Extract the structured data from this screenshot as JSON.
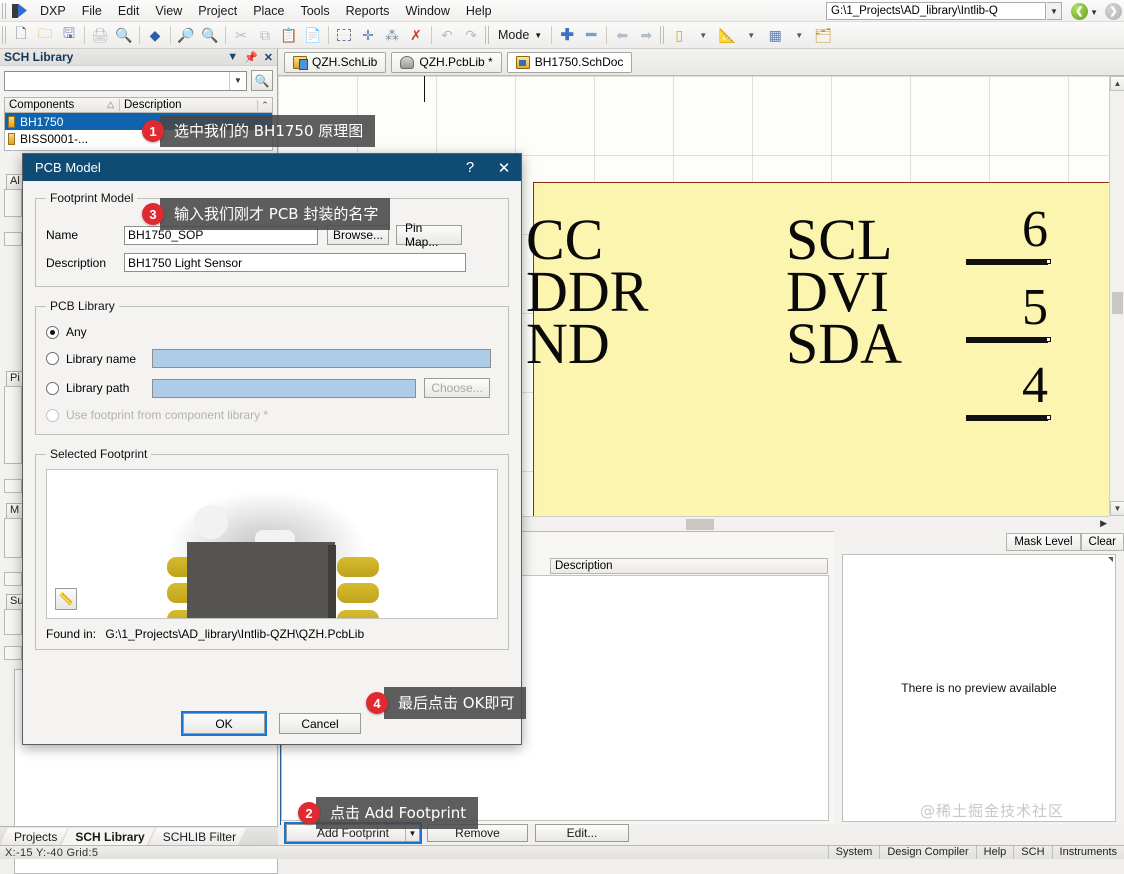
{
  "menu": {
    "app_name": "DXP",
    "items": [
      "File",
      "Edit",
      "View",
      "Project",
      "Place",
      "Tools",
      "Reports",
      "Window",
      "Help"
    ],
    "path_value": "G:\\1_Projects\\AD_library\\Intlib-Q"
  },
  "toolbar": {
    "mode_label": "Mode"
  },
  "sch_library_panel": {
    "title": "SCH Library",
    "search_value": "",
    "columns": [
      "Components",
      "Description"
    ],
    "components": [
      {
        "name": "BH1750",
        "description": "",
        "selected": true
      },
      {
        "name": "BISS0001-...",
        "description": "",
        "selected": false
      }
    ]
  },
  "hidden_sections": [
    {
      "label": "Al"
    },
    {
      "label": "Pi"
    },
    {
      "label": "M"
    },
    {
      "label": "Su"
    }
  ],
  "doc_tabs": [
    {
      "label": "QZH.SchLib",
      "icon": "schlib-icon",
      "active": false
    },
    {
      "label": "QZH.PcbLib *",
      "icon": "pcblib-icon",
      "active": false
    },
    {
      "label": "BH1750.SchDoc",
      "icon": "schdoc-icon",
      "active": true
    }
  ],
  "schematic": {
    "left_pins": [
      "CC",
      "DDR",
      "ND"
    ],
    "right_pins": [
      "SCL",
      "DVI",
      "SDA"
    ],
    "pin_numbers": [
      "6",
      "5",
      "4"
    ]
  },
  "lower_panel": {
    "description_header": "Description"
  },
  "right_panel": {
    "mask_level_label": "Mask Level",
    "clear_label": "Clear",
    "preview_message": "There is no preview available",
    "watermark": "@稀土掘金技术社区"
  },
  "footer_buttons": {
    "add_footprint": "Add Footprint",
    "remove": "Remove",
    "edit": "Edit..."
  },
  "bottom_tabs": [
    {
      "label": "Projects",
      "active": false
    },
    {
      "label": "SCH Library",
      "active": true
    },
    {
      "label": "SCHLIB Filter",
      "active": false
    }
  ],
  "status_bar": {
    "coordinates": "X:-15 Y:-40   Grid:5",
    "right_items": [
      "System",
      "Design Compiler",
      "Help",
      "SCH",
      "Instruments"
    ]
  },
  "dialog": {
    "title": "PCB Model",
    "help_label": "?",
    "close_label": "✕",
    "footprint_model": {
      "legend": "Footprint Model",
      "name_label": "Name",
      "name_value": "BH1750_SOP",
      "browse_label": "Browse...",
      "pin_map_label": "Pin Map...",
      "description_label": "Description",
      "description_value": "BH1750 Light Sensor"
    },
    "pcb_library": {
      "legend": "PCB Library",
      "option_any": "Any",
      "option_library_name": "Library name",
      "option_library_path": "Library path",
      "option_use_footprint": "Use footprint from component library *",
      "library_name_value": "",
      "library_path_value": "",
      "choose_label": "Choose...",
      "selected_option": "Any"
    },
    "selected_footprint": {
      "legend": "Selected Footprint",
      "found_in_label": "Found in:",
      "found_in_path": "G:\\1_Projects\\AD_library\\Intlib-QZH\\QZH.PcbLib"
    },
    "ok_label": "OK",
    "cancel_label": "Cancel"
  },
  "callouts": [
    {
      "number": "1",
      "text": "选中我们的 BH1750 原理图"
    },
    {
      "number": "2",
      "text": "点击 Add Footprint"
    },
    {
      "number": "3",
      "text": "输入我们刚才 PCB 封装的名字"
    },
    {
      "number": "4",
      "text": "最后点击 OK即可"
    }
  ]
}
